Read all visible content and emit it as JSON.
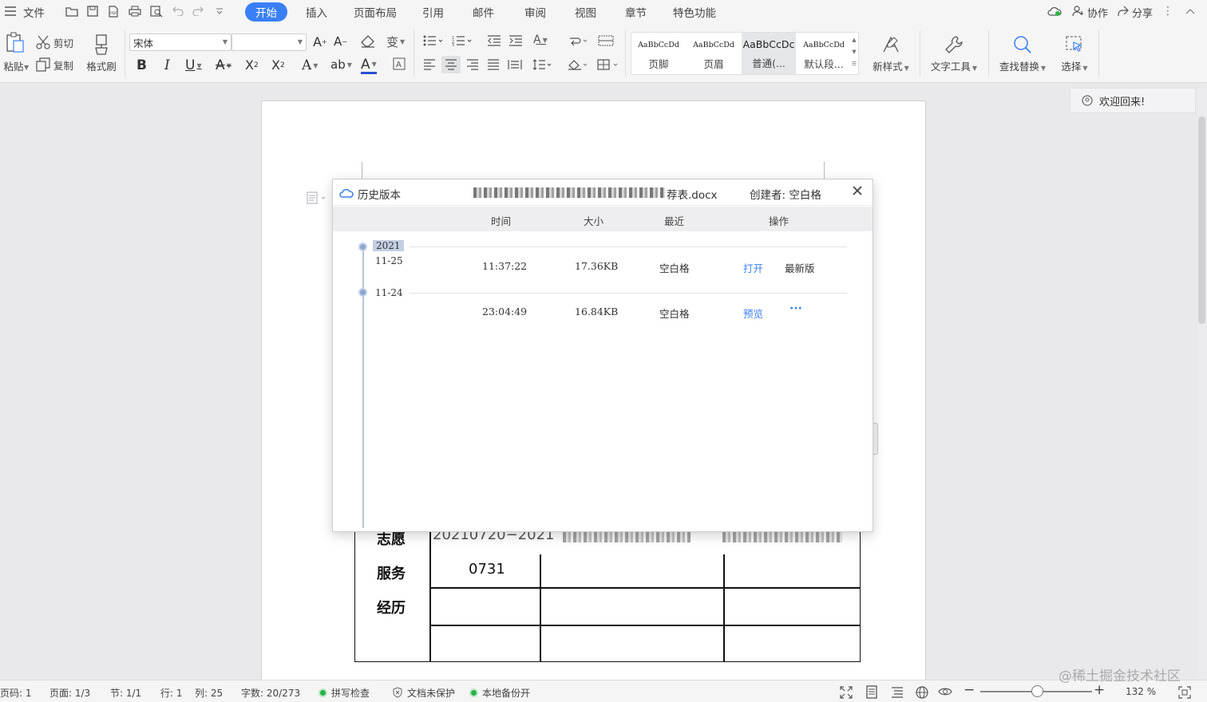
{
  "menu": {
    "file": "文件",
    "tabs": [
      "开始",
      "插入",
      "页面布局",
      "引用",
      "邮件",
      "审阅",
      "视图",
      "章节",
      "特色功能"
    ],
    "active_tab": "开始",
    "collab": "协作",
    "share": "分享"
  },
  "ribbon": {
    "paste": "粘贴",
    "cut": "剪切",
    "copy": "复制",
    "format_painter": "格式刷",
    "font_name": "宋体",
    "font_size": "",
    "styles": [
      {
        "sample": "AaBbCcDd",
        "name": "页脚"
      },
      {
        "sample": "AaBbCcDd",
        "name": "页眉"
      },
      {
        "sample": "AaBbCcDc",
        "name": "普通(..."
      },
      {
        "sample": "AaBbCcDd",
        "name": "默认段..."
      }
    ],
    "new_style": "新样式",
    "text_tools": "文字工具",
    "find_replace": "查找替换",
    "select": "选择"
  },
  "welcome": "欢迎回来!",
  "dialog": {
    "title": "历史版本",
    "filename_suffix": "荐表.docx",
    "creator_label": "创建者: 空白格",
    "columns": [
      "时间",
      "大小",
      "最近",
      "操作"
    ],
    "groups": [
      {
        "year": "2021",
        "date": "11-25",
        "time": "11:37:22",
        "size": "17.36KB",
        "recent": "空白格",
        "action": "打开",
        "note": "最新版"
      },
      {
        "date": "11-24",
        "time": "23:04:49",
        "size": "16.84KB",
        "recent": "空白格",
        "action": "预览",
        "more": "···"
      }
    ]
  },
  "doc_table": {
    "partial_top": "20210720−2021",
    "code": "0731",
    "row_labels": [
      "志愿",
      "服务",
      "经历"
    ]
  },
  "status": {
    "page_code": "页码: 1",
    "page": "页面: 1/3",
    "section": "节: 1/1",
    "row": "行: 1",
    "col": "列: 25",
    "words": "字数: 20/273",
    "spell": "拼写检查",
    "protect": "文档未保护",
    "backup": "本地备份开",
    "zoom": "132 %"
  },
  "watermark": "@稀土掘金技术社区"
}
